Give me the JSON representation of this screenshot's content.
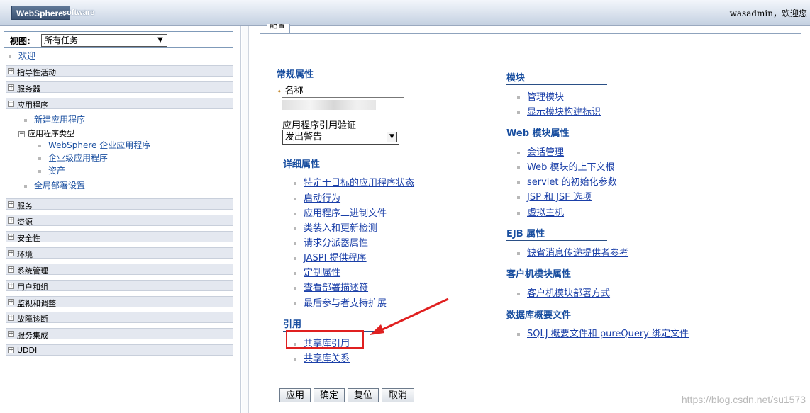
{
  "banner": {
    "logo": "WebSphere.",
    "logo_sub": "software",
    "user_greeting": "wasadmin，欢迎您"
  },
  "nav": {
    "view_label": "视图:",
    "view_select": "所有任务",
    "welcome": "欢迎",
    "groups_top": [
      "指导性活动",
      "服务器"
    ],
    "expanded_group": "应用程序",
    "expanded_items": {
      "new_app": "新建应用程序",
      "app_types": "应用程序类型",
      "websphere_apps": "WebSphere 企业应用程序",
      "business_apps": "企业级应用程序",
      "assets": "资产",
      "global_deploy": "全局部署设置"
    },
    "groups_bottom": [
      "服务",
      "资源",
      "安全性",
      "环境",
      "系统管理",
      "用户和组",
      "监视和调整",
      "故障诊断",
      "服务集成",
      "UDDI"
    ]
  },
  "tab_label": "配置",
  "general": {
    "title": "常规属性",
    "name_label": "名称",
    "validation_label": "应用程序引用验证",
    "validation_value": "发出警告"
  },
  "detail": {
    "title": "详细属性",
    "links": [
      "特定于目标的应用程序状态",
      "启动行为",
      "应用程序二进制文件",
      "类装入和更新检测",
      "请求分派器属性",
      "JASPI 提供程序",
      "定制属性",
      "查看部署描述符",
      "最后参与者支持扩展"
    ]
  },
  "refs": {
    "title": "引用",
    "links": [
      "共享库引用",
      "共享库关系"
    ]
  },
  "modules": {
    "title": "模块",
    "links": [
      "管理模块",
      "显示模块构建标识"
    ]
  },
  "web_modules": {
    "title": "Web 模块属性",
    "links": [
      "会话管理",
      "Web 模块的上下文根",
      "servlet 的初始化参数",
      "JSP 和 JSF 选项",
      "虚拟主机"
    ]
  },
  "ejb": {
    "title": "EJB 属性",
    "links": [
      "缺省消息传递提供者参考"
    ]
  },
  "client_modules": {
    "title": "客户机模块属性",
    "links": [
      "客户机模块部署方式"
    ]
  },
  "db_profiles": {
    "title": "数据库概要文件",
    "links": [
      "SQLJ 概要文件和 pureQuery 绑定文件"
    ]
  },
  "buttons": {
    "apply": "应用",
    "ok": "确定",
    "reset": "复位",
    "cancel": "取消"
  },
  "watermark": "https://blog.csdn.net/su1573"
}
